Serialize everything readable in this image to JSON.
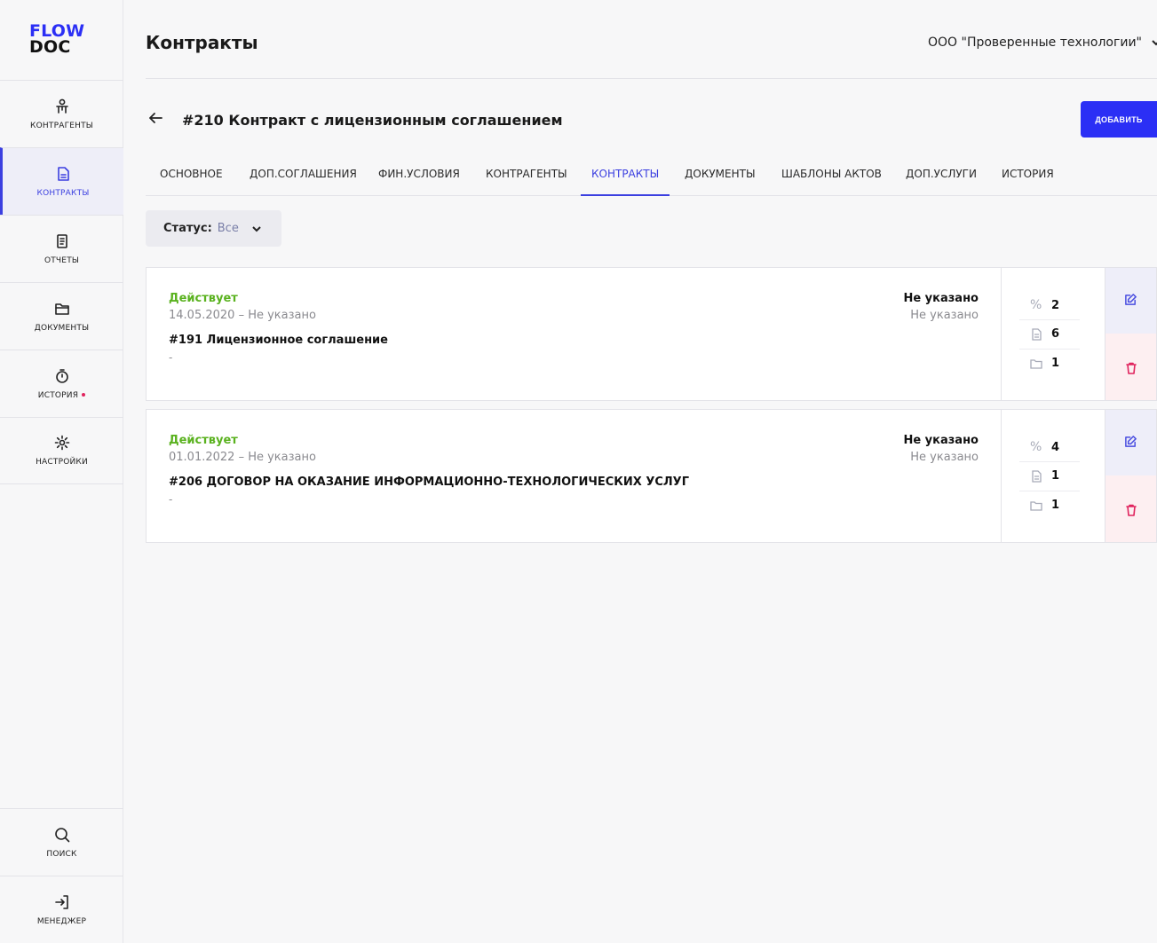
{
  "logo": {
    "line1": "FLOW",
    "line2": "DOC"
  },
  "sidebar": {
    "items": [
      {
        "label": "КОНТРАГЕНТЫ",
        "icon": "person-icon"
      },
      {
        "label": "КОНТРАКТЫ",
        "icon": "document-icon",
        "active": true
      },
      {
        "label": "ОТЧЕТЫ",
        "icon": "report-icon"
      },
      {
        "label": "ДОКУМЕНТЫ",
        "icon": "folder-icon"
      },
      {
        "label": "ИСТОРИЯ",
        "icon": "timer-icon",
        "has_dot": true
      },
      {
        "label": "НАСТРОЙКИ",
        "icon": "gear-icon"
      }
    ],
    "bottom": [
      {
        "label": "ПОИСК",
        "icon": "search-icon"
      },
      {
        "label": "МЕНЕДЖЕР",
        "icon": "login-icon"
      }
    ]
  },
  "header": {
    "title": "Контракты",
    "org": "ООО \"Проверенные технологии\""
  },
  "contract": {
    "title": "#210 Контракт с лицензионным соглашением",
    "add_label": "ДОБАВИТЬ"
  },
  "tabs": [
    {
      "label": "ОСНОВНОЕ"
    },
    {
      "label": "ДОП.СОГЛАШЕНИЯ"
    },
    {
      "label": "ФИН.УСЛОВИЯ"
    },
    {
      "label": "КОНТРАГЕНТЫ"
    },
    {
      "label": "КОНТРАКТЫ",
      "active": true
    },
    {
      "label": "ДОКУМЕНТЫ"
    },
    {
      "label": "ШАБЛОНЫ АКТОВ"
    },
    {
      "label": "ДОП.УСЛУГИ"
    },
    {
      "label": "ИСТОРИЯ"
    }
  ],
  "filter": {
    "label": "Статус:",
    "value": "Все"
  },
  "cards": [
    {
      "status": "Действует",
      "dates": "14.05.2020 – Не указано",
      "name": "#191 Лицензионное соглашение",
      "note": "-",
      "right_title": "Не указано",
      "right_sub": "Не указано",
      "stats": {
        "percent": "2",
        "docs": "6",
        "folders": "1"
      }
    },
    {
      "status": "Действует",
      "dates": "01.01.2022 – Не указано",
      "name": "#206 ДОГОВОР НА ОКАЗАНИЕ ИНФОРМАЦИОННО-ТЕХНОЛОГИЧЕСКИХ УСЛУГ",
      "note": "-",
      "right_title": "Не указано",
      "right_sub": "Не указано",
      "stats": {
        "percent": "4",
        "docs": "1",
        "folders": "1"
      }
    }
  ],
  "colors": {
    "accent": "#2b2ff5",
    "status_active": "#5ab21f",
    "danger": "#e0245e"
  }
}
